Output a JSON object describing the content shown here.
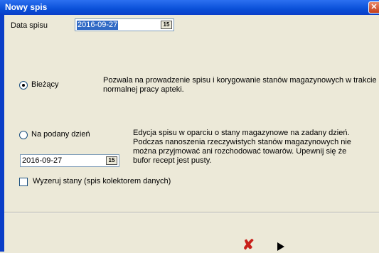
{
  "window": {
    "title": "Nowy spis"
  },
  "date_spisu": {
    "label": "Data spisu",
    "value": "2016-09-27",
    "calendar_icon": "15"
  },
  "option_current": {
    "label": "Bieżący",
    "description": "Pozwala na prowadzenie spisu i korygowanie stanów magazynowych w trakcie normalnej pracy apteki.",
    "selected": true
  },
  "option_day": {
    "label": "Na podany dzień",
    "date_value": "2016-09-27",
    "calendar_icon": "15",
    "description": "Edycja spisu w oparciu o stany magazynowe na zadany dzień. Podczas nanoszenia rzeczywistych stanów magazynowych nie można przyjmować ani rozchodować towarów. Upewnij się że bufor recept jest pusty.",
    "selected": false
  },
  "reset_checkbox": {
    "label": "Wyzeruj stany (spis kolektorem danych)",
    "checked": false
  },
  "footer": {
    "cancel_icon": "✘",
    "next_icon": "play-arrow-icon"
  },
  "colors": {
    "title_bar": "#0a50d8",
    "dialog_bg": "#ece9d8",
    "selection": "#316ac5",
    "cancel": "#c8201a"
  }
}
